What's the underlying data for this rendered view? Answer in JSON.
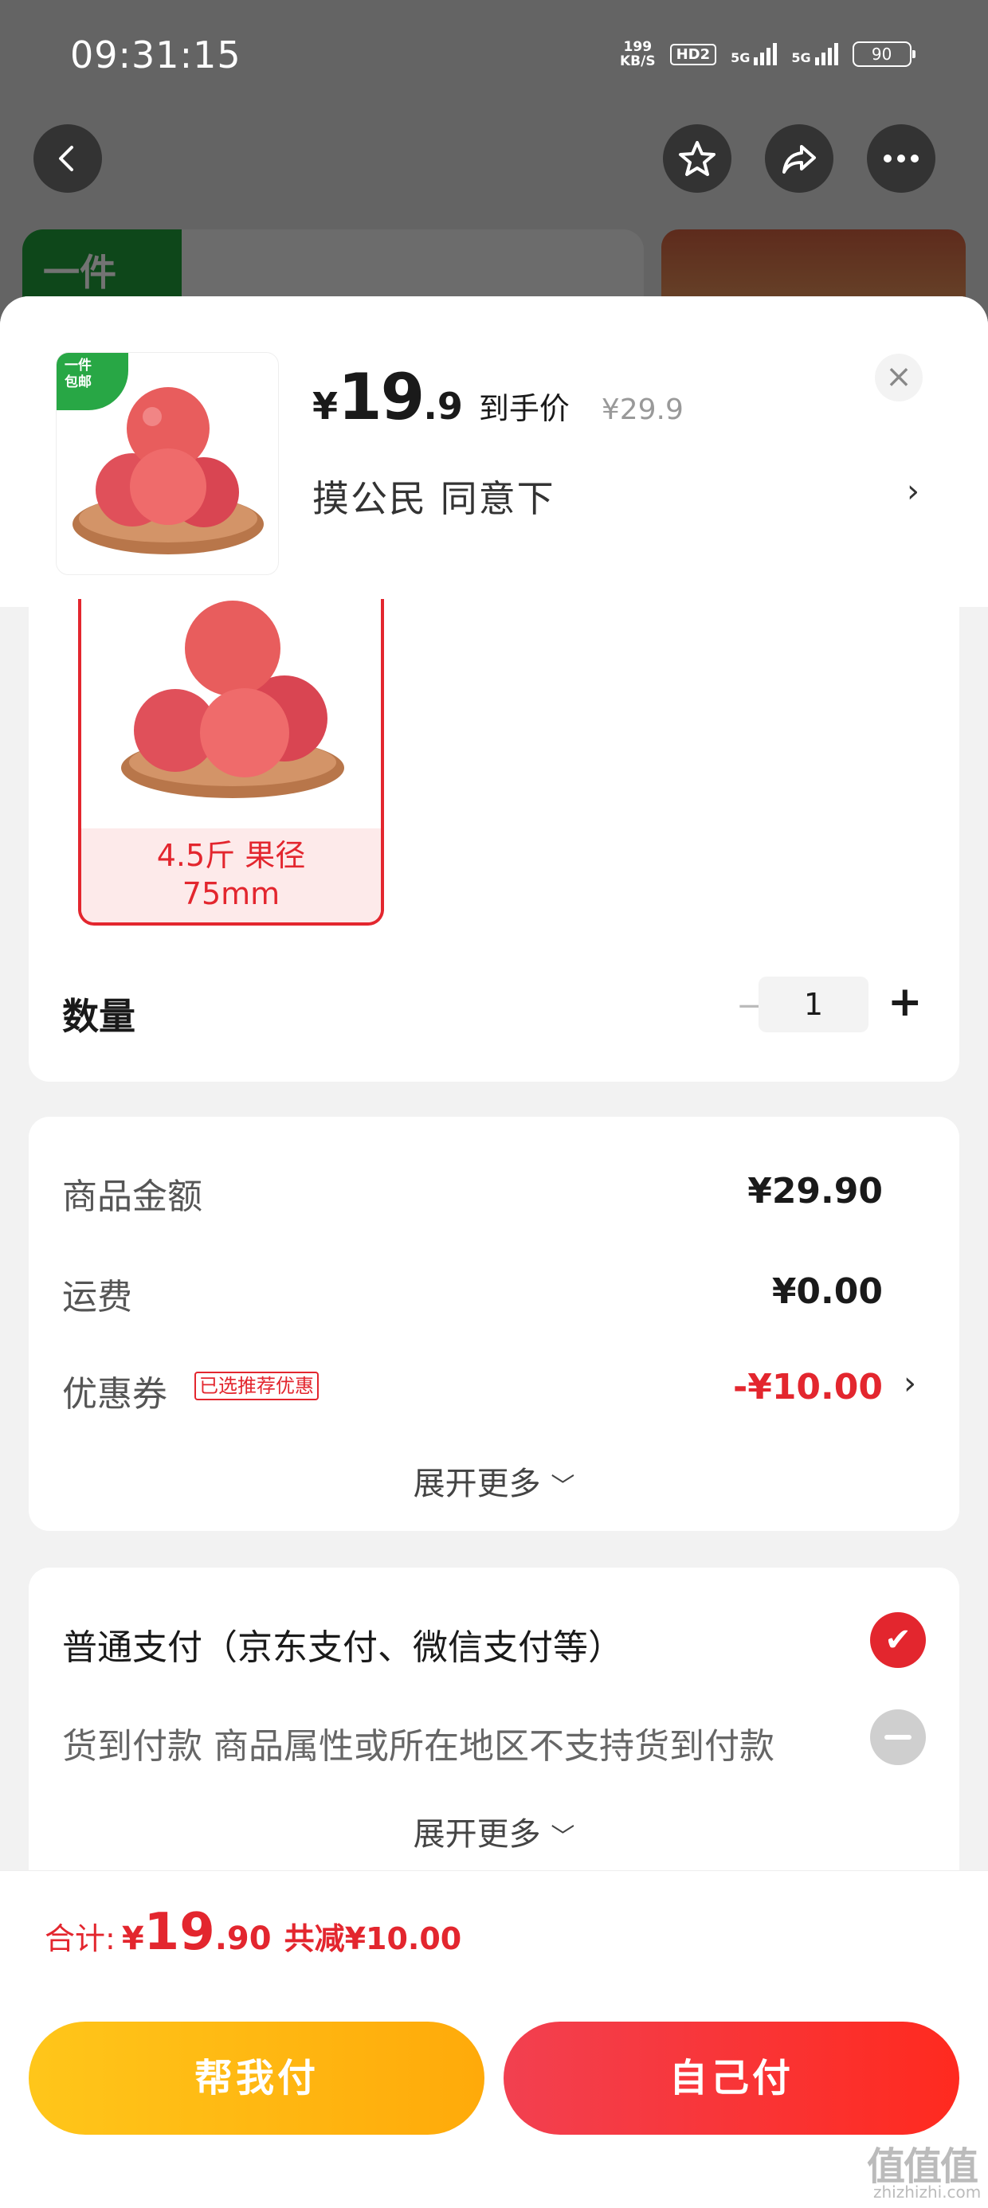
{
  "status_bar": {
    "time": "09:31:15",
    "speed_top": "199",
    "speed_bottom": "KB/S",
    "hd": "HD2",
    "net1": "5G",
    "net2": "5G",
    "battery": "90"
  },
  "top_bar_bg": {
    "tag": "一件"
  },
  "header": {
    "badge_line1": "一件",
    "badge_line2": "包邮",
    "currency": "¥",
    "price_int": "19",
    "price_dec": ".9",
    "price_tag": "到手价",
    "original_price": "¥29.9",
    "spec_selected": "摸公民  同意下",
    "close": "×",
    "chevron": "›"
  },
  "spec_option": {
    "label": "4.5斤 果径\n75mm"
  },
  "quantity": {
    "label": "数量",
    "minus": "−",
    "value": "1",
    "plus": "+"
  },
  "summary": {
    "goods_label": "商品金额",
    "goods_value": "¥29.90",
    "shipping_label": "运费",
    "shipping_value": "¥0.00",
    "coupon_label": "优惠券",
    "coupon_tag": "已选推荐优惠",
    "coupon_value": "-¥10.00",
    "more": "展开更多"
  },
  "payment": {
    "normal": "普通支付（京东支付、微信支付等）",
    "cod": "货到付款 商品属性或所在地区不支持货到付款",
    "more": "展开更多"
  },
  "total": {
    "label": "合计:",
    "currency": "¥",
    "int": "19",
    "dec": ".90",
    "saved": "共减¥10.00"
  },
  "buttons": {
    "help_pay": "帮我付",
    "self_pay": "自己付"
  },
  "watermark": {
    "main": "值值值",
    "sub": "zhizhizhi.com"
  },
  "colors": {
    "accent": "#e3262e",
    "yellow": "#ffb21a",
    "green": "#28a745"
  }
}
